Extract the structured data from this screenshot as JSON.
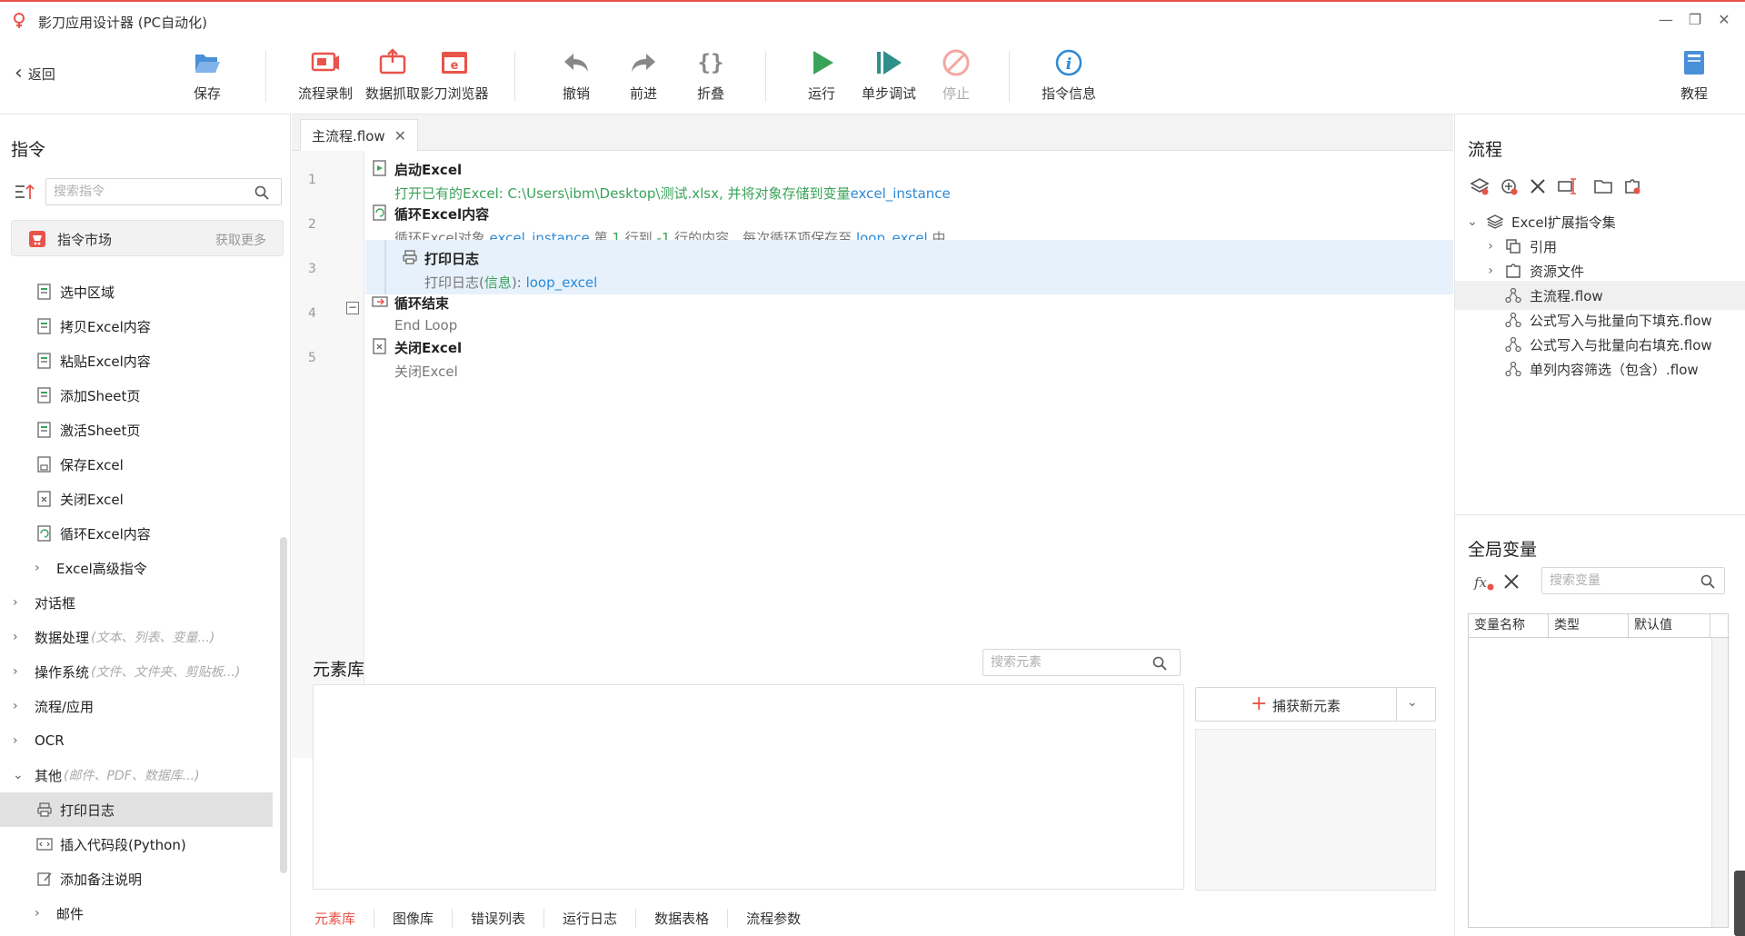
{
  "app": {
    "title": "影刀应用设计器 (PC自动化)"
  },
  "toolbar": {
    "back": "返回",
    "items": [
      "保存",
      "流程录制",
      "数据抓取",
      "影刀浏览器",
      "撤销",
      "前进",
      "折叠",
      "运行",
      "单步调试",
      "停止",
      "指令信息",
      "教程"
    ]
  },
  "commands": {
    "title": "指令",
    "search_placeholder": "搜索指令",
    "market_label": "指令市场",
    "market_more": "获取更多",
    "items": [
      {
        "label": "选中区域",
        "sub": ""
      },
      {
        "label": "拷贝Excel内容",
        "sub": ""
      },
      {
        "label": "粘贴Excel内容",
        "sub": ""
      },
      {
        "label": "添加Sheet页",
        "sub": ""
      },
      {
        "label": "激活Sheet页",
        "sub": ""
      },
      {
        "label": "保存Excel",
        "sub": ""
      },
      {
        "label": "关闭Excel",
        "sub": ""
      },
      {
        "label": "循环Excel内容",
        "sub": ""
      },
      {
        "label": "Excel高级指令",
        "sub": ""
      },
      {
        "label": "对话框",
        "sub": ""
      },
      {
        "label": "数据处理",
        "sub": "(文本、列表、变量...)"
      },
      {
        "label": "操作系统",
        "sub": "(文件、文件夹、剪贴板...)"
      },
      {
        "label": "流程/应用",
        "sub": ""
      },
      {
        "label": "OCR",
        "sub": ""
      },
      {
        "label": "其他",
        "sub": "(邮件、PDF、数据库...)"
      },
      {
        "label": "打印日志",
        "sub": ""
      },
      {
        "label": "插入代码段(Python)",
        "sub": ""
      },
      {
        "label": "添加备注说明",
        "sub": ""
      },
      {
        "label": "邮件",
        "sub": ""
      }
    ]
  },
  "editor": {
    "tab": "主流程.flow",
    "line_numbers": [
      "1",
      "2",
      "3",
      "4",
      "5"
    ],
    "steps": [
      {
        "title": "启动Excel",
        "d1": "打开已有的Excel: C:\\Users\\ibm\\Desktop\\测试.xlsx, 并将对象存储到变量",
        "d2": "excel_instance"
      },
      {
        "title": "循环Excel内容",
        "d1": "循环Excel对象 ",
        "d2": "excel_instance",
        "d3": " 第 ",
        "d4": "1",
        "d5": " 行到 ",
        "d6": "-1",
        "d7": " 行的内容，每次循环项保存至 ",
        "d8": "loop_excel",
        "d9": " 中"
      },
      {
        "title": "打印日志",
        "d1": "打印日志(",
        "d2": "信息",
        "d3": "):  ",
        "d4": "loop_excel"
      },
      {
        "title": "循环结束",
        "d1": "End Loop"
      },
      {
        "title": "关闭Excel",
        "d1": "关闭Excel"
      }
    ]
  },
  "element_library": {
    "title": "元素库",
    "search_placeholder": "搜索元素",
    "capture": "捕获新元素",
    "tabs": [
      "元素库",
      "图像库",
      "错误列表",
      "运行日志",
      "数据表格",
      "流程参数"
    ]
  },
  "flow_panel": {
    "title": "流程",
    "tree": [
      {
        "label": "Excel扩展指令集"
      },
      {
        "label": "引用"
      },
      {
        "label": "资源文件"
      },
      {
        "label": "主流程.flow"
      },
      {
        "label": "公式写入与批量向下填充.flow"
      },
      {
        "label": "公式写入与批量向右填充.flow"
      },
      {
        "label": "单列内容筛选（包含）.flow"
      }
    ]
  },
  "globals": {
    "title": "全局变量",
    "search_placeholder": "搜索变量",
    "columns": [
      "变量名称",
      "类型",
      "默认值"
    ]
  },
  "colors": {
    "accent": "#e8534a",
    "green": "#3aa35a",
    "blue": "#2c8ad6",
    "highlight": "#e7f1fb"
  }
}
